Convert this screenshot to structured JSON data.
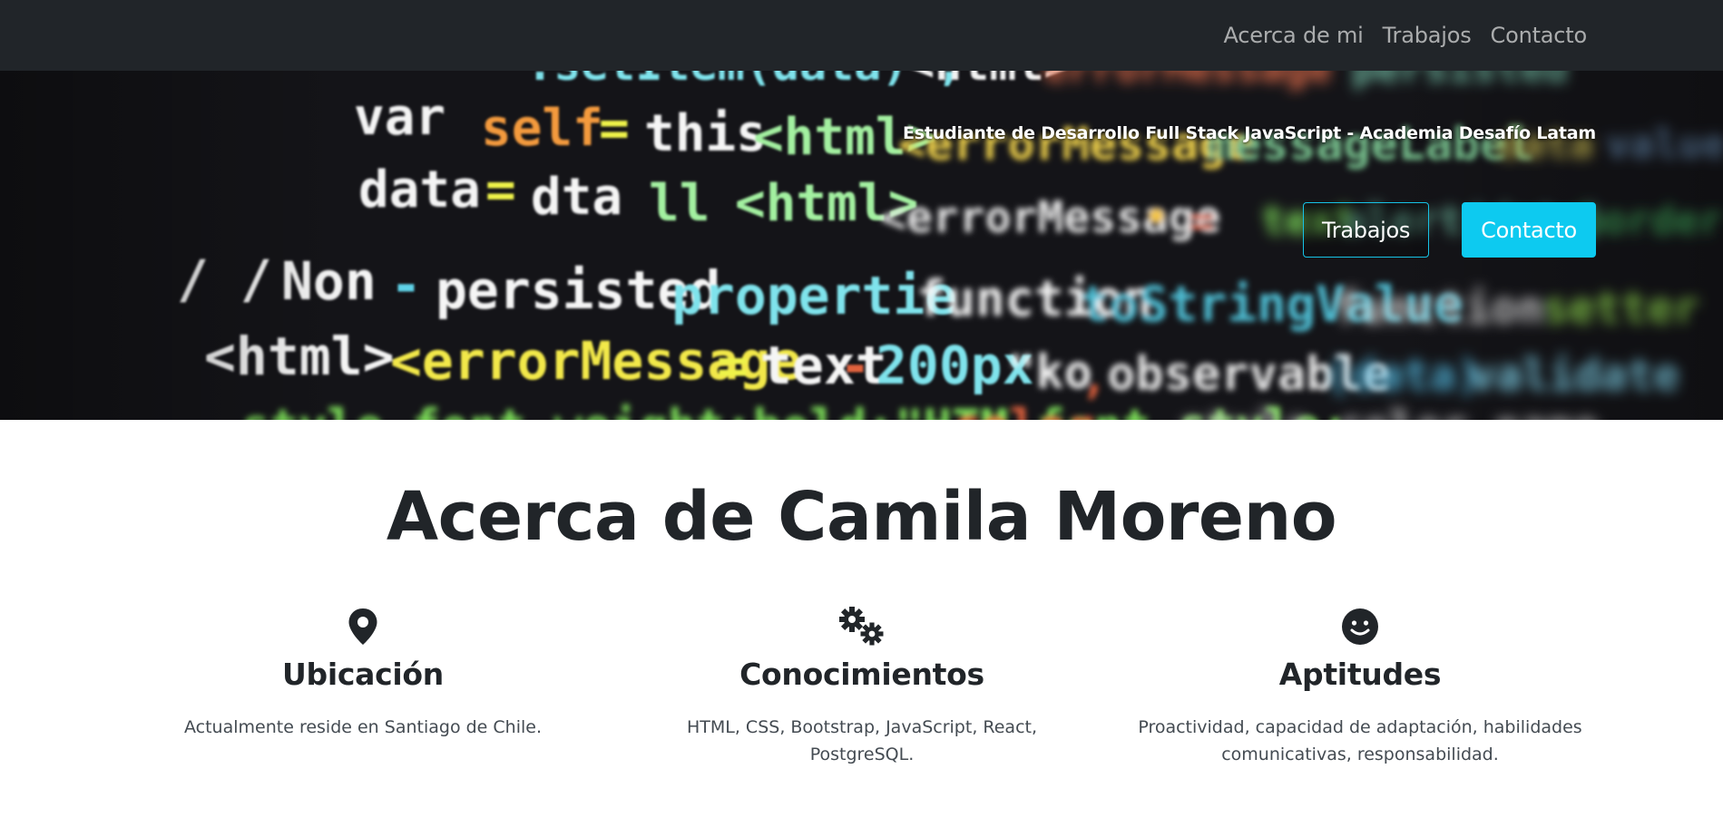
{
  "nav": {
    "links": [
      "Acerca de mi",
      "Trabajos",
      "Contacto"
    ]
  },
  "hero": {
    "subtitle": "Estudiante de Desarrollo Full Stack JavaScript - Academia Desafío Latam",
    "buttons": {
      "works": "Trabajos",
      "contact": "Contacto"
    }
  },
  "about": {
    "title": "Acerca de Camila Moreno",
    "features": [
      {
        "icon": "map-marker-icon",
        "title": "Ubicación",
        "text": "Actualmente reside en Santiago de Chile."
      },
      {
        "icon": "gears-icon",
        "title": "Conocimientos",
        "text": "HTML, CSS, Bootstrap, JavaScript, React, PostgreSQL."
      },
      {
        "icon": "smile-icon",
        "title": "Aptitudes",
        "text": "Proactividad, capacidad de adaptación, habilidades comunicativas, responsabilidad."
      }
    ]
  },
  "colors": {
    "navbar": "#212529",
    "accent": "#0dcaf0",
    "text": "#212529"
  }
}
